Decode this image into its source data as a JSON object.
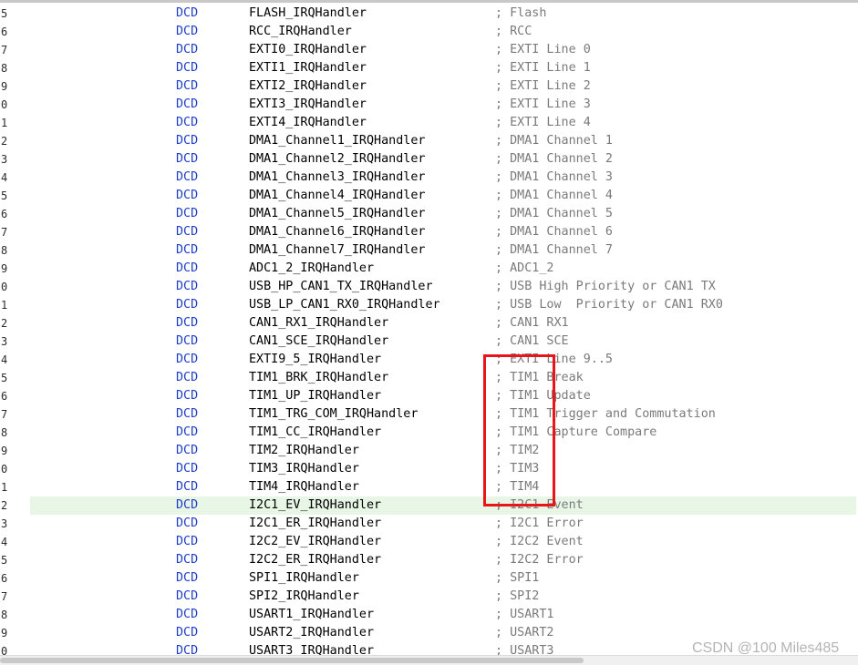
{
  "editor": {
    "highlight_color": "#e8f6e6",
    "directive_color": "#1f3fc8",
    "comment_color": "#7a7a7a",
    "current_line_index": 27,
    "lines": [
      {
        "num": "5",
        "directive": "DCD",
        "symbol": "FLASH_IRQHandler",
        "comment": "; Flash"
      },
      {
        "num": "6",
        "directive": "DCD",
        "symbol": "RCC_IRQHandler",
        "comment": "; RCC"
      },
      {
        "num": "7",
        "directive": "DCD",
        "symbol": "EXTI0_IRQHandler",
        "comment": "; EXTI Line 0"
      },
      {
        "num": "8",
        "directive": "DCD",
        "symbol": "EXTI1_IRQHandler",
        "comment": "; EXTI Line 1"
      },
      {
        "num": "9",
        "directive": "DCD",
        "symbol": "EXTI2_IRQHandler",
        "comment": "; EXTI Line 2"
      },
      {
        "num": "0",
        "directive": "DCD",
        "symbol": "EXTI3_IRQHandler",
        "comment": "; EXTI Line 3"
      },
      {
        "num": "1",
        "directive": "DCD",
        "symbol": "EXTI4_IRQHandler",
        "comment": "; EXTI Line 4"
      },
      {
        "num": "2",
        "directive": "DCD",
        "symbol": "DMA1_Channel1_IRQHandler",
        "comment": "; DMA1 Channel 1"
      },
      {
        "num": "3",
        "directive": "DCD",
        "symbol": "DMA1_Channel2_IRQHandler",
        "comment": "; DMA1 Channel 2"
      },
      {
        "num": "4",
        "directive": "DCD",
        "symbol": "DMA1_Channel3_IRQHandler",
        "comment": "; DMA1 Channel 3"
      },
      {
        "num": "5",
        "directive": "DCD",
        "symbol": "DMA1_Channel4_IRQHandler",
        "comment": "; DMA1 Channel 4"
      },
      {
        "num": "6",
        "directive": "DCD",
        "symbol": "DMA1_Channel5_IRQHandler",
        "comment": "; DMA1 Channel 5"
      },
      {
        "num": "7",
        "directive": "DCD",
        "symbol": "DMA1_Channel6_IRQHandler",
        "comment": "; DMA1 Channel 6"
      },
      {
        "num": "8",
        "directive": "DCD",
        "symbol": "DMA1_Channel7_IRQHandler",
        "comment": "; DMA1 Channel 7"
      },
      {
        "num": "9",
        "directive": "DCD",
        "symbol": "ADC1_2_IRQHandler",
        "comment": "; ADC1_2"
      },
      {
        "num": "0",
        "directive": "DCD",
        "symbol": "USB_HP_CAN1_TX_IRQHandler",
        "comment": "; USB High Priority or CAN1 TX"
      },
      {
        "num": "1",
        "directive": "DCD",
        "symbol": "USB_LP_CAN1_RX0_IRQHandler",
        "comment": "; USB Low  Priority or CAN1 RX0"
      },
      {
        "num": "2",
        "directive": "DCD",
        "symbol": "CAN1_RX1_IRQHandler",
        "comment": "; CAN1 RX1"
      },
      {
        "num": "3",
        "directive": "DCD",
        "symbol": "CAN1_SCE_IRQHandler",
        "comment": "; CAN1 SCE"
      },
      {
        "num": "4",
        "directive": "DCD",
        "symbol": "EXTI9_5_IRQHandler",
        "comment": "; EXTI Line 9..5"
      },
      {
        "num": "5",
        "directive": "DCD",
        "symbol": "TIM1_BRK_IRQHandler",
        "comment": "; TIM1 Break"
      },
      {
        "num": "6",
        "directive": "DCD",
        "symbol": "TIM1_UP_IRQHandler",
        "comment": "; TIM1 Update"
      },
      {
        "num": "7",
        "directive": "DCD",
        "symbol": "TIM1_TRG_COM_IRQHandler",
        "comment": "; TIM1 Trigger and Commutation"
      },
      {
        "num": "8",
        "directive": "DCD",
        "symbol": "TIM1_CC_IRQHandler",
        "comment": "; TIM1 Capture Compare"
      },
      {
        "num": "9",
        "directive": "DCD",
        "symbol": "TIM2_IRQHandler",
        "comment": "; TIM2"
      },
      {
        "num": "0",
        "directive": "DCD",
        "symbol": "TIM3_IRQHandler",
        "comment": "; TIM3"
      },
      {
        "num": "1",
        "directive": "DCD",
        "symbol": "TIM4_IRQHandler",
        "comment": "; TIM4"
      },
      {
        "num": "2",
        "directive": "DCD",
        "symbol": "I2C1_EV_IRQHandler",
        "comment": "; I2C1 Event"
      },
      {
        "num": "3",
        "directive": "DCD",
        "symbol": "I2C1_ER_IRQHandler",
        "comment": "; I2C1 Error"
      },
      {
        "num": "4",
        "directive": "DCD",
        "symbol": "I2C2_EV_IRQHandler",
        "comment": "; I2C2 Event"
      },
      {
        "num": "5",
        "directive": "DCD",
        "symbol": "I2C2_ER_IRQHandler",
        "comment": "; I2C2 Error"
      },
      {
        "num": "6",
        "directive": "DCD",
        "symbol": "SPI1_IRQHandler",
        "comment": "; SPI1"
      },
      {
        "num": "7",
        "directive": "DCD",
        "symbol": "SPI2_IRQHandler",
        "comment": "; SPI2"
      },
      {
        "num": "8",
        "directive": "DCD",
        "symbol": "USART1_IRQHandler",
        "comment": "; USART1"
      },
      {
        "num": "9",
        "directive": "DCD",
        "symbol": "USART2_IRQHandler",
        "comment": "; USART2"
      },
      {
        "num": "0",
        "directive": "DCD",
        "symbol": "USART3_IRQHandler",
        "comment": "; USART3"
      }
    ]
  },
  "annotation": {
    "color": "#e8151b"
  },
  "watermark": {
    "text": "CSDN @100 Miles485"
  }
}
